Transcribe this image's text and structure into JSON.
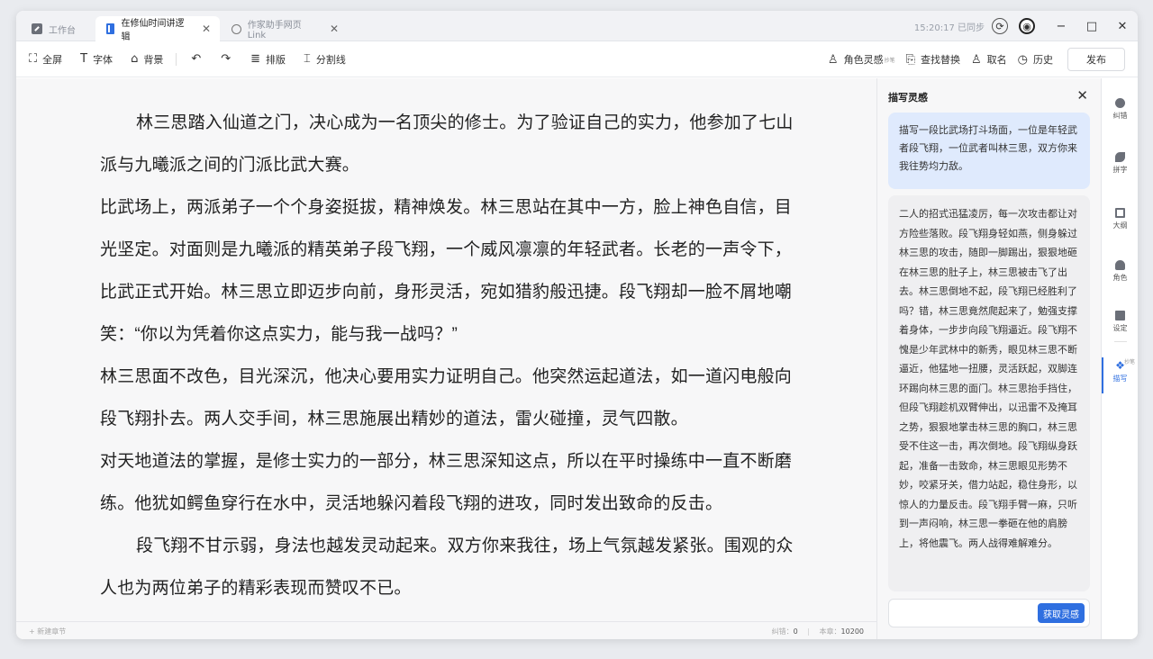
{
  "tabs": [
    {
      "label": "工作台",
      "icon": "workbench-icon",
      "active": false
    },
    {
      "label": "在修仙时间讲逻辑",
      "icon": "document-icon",
      "active": true
    },
    {
      "label": "作家助手网页Link",
      "icon": "globe-icon",
      "active": false
    }
  ],
  "titlebar": {
    "sync_status": "15:20:17 已同步",
    "minimize": "−",
    "maximize": "□",
    "close": "✕"
  },
  "toolbar": {
    "fullscreen": "全屏",
    "font": "字体",
    "background": "背景",
    "layout": "排版",
    "divider": "分割线",
    "character_inspiration": "角色灵感",
    "character_inspiration_tag": "抄笔",
    "find_replace": "查找替换",
    "naming": "取名",
    "history": "历史",
    "publish": "发布"
  },
  "editor": {
    "paragraphs": [
      "林三思踏入仙道之门，决心成为一名顶尖的修士。为了验证自己的实力，他参加了七山派与九曦派之间的门派比武大赛。",
      "比武场上，两派弟子一个个身姿挺拔，精神焕发。林三思站在其中一方，脸上神色自信，目光坚定。对面则是九曦派的精英弟子段飞翔，一个威风凛凛的年轻武者。长老的一声令下，比武正式开始。林三思立即迈步向前，身形灵活，宛如猎豹般迅捷。段飞翔却一脸不屑地嘲笑：“你以为凭着你这点实力，能与我一战吗？”",
      "林三思面不改色，目光深沉，他决心要用实力证明自己。他突然运起道法，如一道闪电般向段飞翔扑去。两人交手间，林三思施展出精妙的道法，雷火碰撞，灵气四散。",
      "对天地道法的掌握，是修士实力的一部分，林三思深知这点，所以在平时操练中一直不断磨练。他犹如鳄鱼穿行在水中，灵活地躲闪着段飞翔的进攻，同时发出致命的反击。",
      "段飞翔不甘示弱，身法也越发灵动起来。双方你来我往，场上气氛越发紧张。围观的众人也为两位弟子的精彩表现而赞叹不已。"
    ]
  },
  "status": {
    "new_chapter": "+ 新建章节",
    "errors_label": "纠错：",
    "errors_value": "0",
    "chapter_label": "本章：",
    "chapter_value": "10200"
  },
  "panel": {
    "title": "描写灵感",
    "prompt": "描写一段比武场打斗场面，一位是年轻武者段飞翔，一位武者叫林三思，双方你来我往势均力敌。",
    "result": "二人的招式迅猛凌厉，每一次攻击都让对方险些落败。段飞翔身轻如燕，侧身躲过林三思的攻击，随即一脚踢出，狠狠地砸在林三思的肚子上，林三思被击飞了出去。林三思倒地不起，段飞翔已经胜利了吗？错，林三思竟然爬起来了，勉强支撑着身体，一步步向段飞翔逼近。段飞翔不愧是少年武林中的新秀，眼见林三思不断逼近，他猛地一扭腰，灵活跃起，双脚连环踢向林三思的面门。林三思抬手挡住，但段飞翔趁机双臂伸出，以迅雷不及掩耳之势，狠狠地掌击林三思的胸口，林三思受不住这一击，再次倒地。段飞翔纵身跃起，准备一击致命，林三思眼见形势不妙，咬紧牙关，借力站起，稳住身形，以惊人的力量反击。段飞翔手臂一麻，只听到一声闷响，林三思一拳砸在他的肩膀上，将他震飞。两人战得难解难分。",
    "get_button": "获取灵感"
  },
  "rail": {
    "items": [
      {
        "label": "纠错",
        "icon": "check-icon"
      },
      {
        "label": "拼字",
        "icon": "pen-icon"
      },
      {
        "label": "大纲",
        "icon": "outline-icon"
      },
      {
        "label": "角色",
        "icon": "user-icon"
      },
      {
        "label": "设定",
        "icon": "settings-icon"
      },
      {
        "label": "描写",
        "icon": "sparkle-icon",
        "tag": "抄笔"
      }
    ]
  },
  "colors": {
    "accent": "#2f6fe0",
    "prompt_bg": "#dfeafd",
    "editor_bg": "#f7f7f8"
  }
}
